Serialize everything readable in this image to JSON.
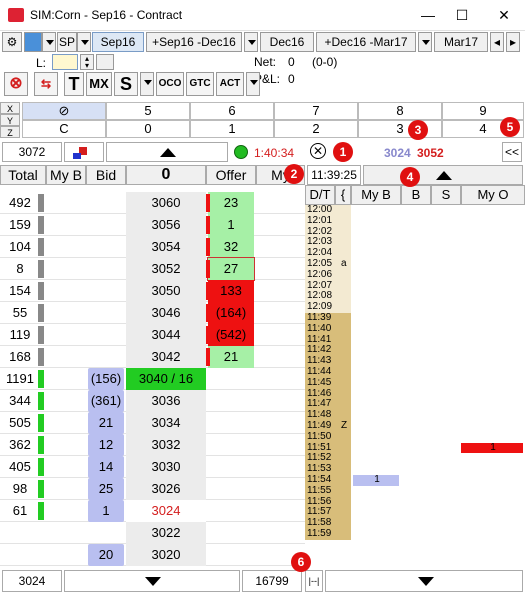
{
  "window": {
    "title": "SIM:Corn - Sep16 - Contract",
    "minimize": "—",
    "maximize": "☐",
    "close": "✕"
  },
  "toolbar": {
    "sp_label": "SP",
    "tabs": [
      "Sep16",
      "+Sep16 -Dec16",
      "Dec16",
      "+Dec16 -Mar17",
      "Mar17"
    ],
    "scroll_left": "◂",
    "scroll_right": "▸"
  },
  "order": {
    "l_label": "L:",
    "l_value": "",
    "net_label": "Net:",
    "net_value": "0",
    "net_detail": "(0-0)",
    "pnl_label": "P&L:",
    "pnl_value": "0"
  },
  "buttons": {
    "t": "T",
    "mx": "MX",
    "s": "S",
    "oco": "OCO",
    "gtc": "GTC",
    "act": "ACT"
  },
  "xyz": {
    "keys": [
      "X",
      "Y",
      "Z"
    ],
    "top_row": [
      "5",
      "6",
      "7",
      "8",
      "9"
    ],
    "bottom_row": [
      "C",
      "0",
      "1",
      "2",
      "3",
      "4"
    ]
  },
  "controls": {
    "price_box": "3072",
    "timer": "1:40:34",
    "bid_price": "3024",
    "ask_price": "3052",
    "collapse": "<<",
    "time_box": "11:39:25"
  },
  "columns": {
    "total": "Total",
    "myb": "My B",
    "bid": "Bid",
    "center": "0",
    "offer": "Offer",
    "myo": "My"
  },
  "ladder": [
    {
      "total": "492",
      "bid": "",
      "price": "3060",
      "offer": "23",
      "offer_style": "g"
    },
    {
      "total": "159",
      "bid": "",
      "price": "3056",
      "offer": "1",
      "offer_style": "g"
    },
    {
      "total": "104",
      "bid": "",
      "price": "3054",
      "offer": "32",
      "offer_style": "g"
    },
    {
      "total": "8",
      "bid": "",
      "price": "3052",
      "offer": "27",
      "offer_style": "gb"
    },
    {
      "total": "154",
      "bid": "",
      "price": "3050",
      "offer": "133",
      "offer_style": "r"
    },
    {
      "total": "55",
      "bid": "",
      "price": "3046",
      "offer": "(164)",
      "offer_style": "r"
    },
    {
      "total": "119",
      "bid": "",
      "price": "3044",
      "offer": "(542)",
      "offer_style": "r"
    },
    {
      "total": "168",
      "bid": "",
      "price": "3042",
      "offer": "21",
      "offer_style": "g"
    },
    {
      "total": "1191",
      "bid": "(156)",
      "price": "3040 / 16",
      "offer": "",
      "offer_style": "",
      "last": true
    },
    {
      "total": "344",
      "bid": "(361)",
      "price": "3036",
      "offer": "",
      "offer_style": ""
    },
    {
      "total": "505",
      "bid": "21",
      "price": "3034",
      "offer": "",
      "offer_style": ""
    },
    {
      "total": "362",
      "bid": "12",
      "price": "3032",
      "offer": "",
      "offer_style": ""
    },
    {
      "total": "405",
      "bid": "14",
      "price": "3030",
      "offer": "",
      "offer_style": ""
    },
    {
      "total": "98",
      "bid": "25",
      "price": "3026",
      "offer": "",
      "offer_style": ""
    },
    {
      "total": "61",
      "bid": "1",
      "price": "3024",
      "offer": "",
      "offer_style": "",
      "cur": true
    },
    {
      "total": "",
      "bid": "",
      "price": "3022",
      "offer": "",
      "offer_style": ""
    },
    {
      "total": "",
      "bid": "20",
      "price": "3020",
      "offer": "",
      "offer_style": ""
    }
  ],
  "right_panel": {
    "headers": [
      "D/T",
      "{",
      "My B",
      "B",
      "S",
      "My O"
    ],
    "times": [
      "12:00",
      "12:01",
      "12:02",
      "12:03",
      "12:04",
      "12:05",
      "12:06",
      "12:07",
      "12:08",
      "12:09",
      "11:39",
      "11:40",
      "11:41",
      "11:42",
      "11:43",
      "11:44",
      "11:45",
      "11:46",
      "11:47",
      "11:48",
      "11:49",
      "11:50",
      "11:51",
      "11:52",
      "11:53",
      "11:54",
      "11:55",
      "11:56",
      "11:57",
      "11:58",
      "11:59"
    ],
    "mark_a": "a",
    "mark_z": "Z",
    "my_b_fill": "1",
    "my_o_fill": "1"
  },
  "bottom": {
    "left_value": "3024",
    "right_value": "16799",
    "small_btn": "|--|"
  },
  "callouts": [
    "1",
    "2",
    "3",
    "4",
    "5",
    "6"
  ],
  "colors": {
    "green": "#22cc22",
    "red": "#ee1111",
    "bid_blue": "#b9bff0",
    "time_tan": "#d8bd7a"
  }
}
